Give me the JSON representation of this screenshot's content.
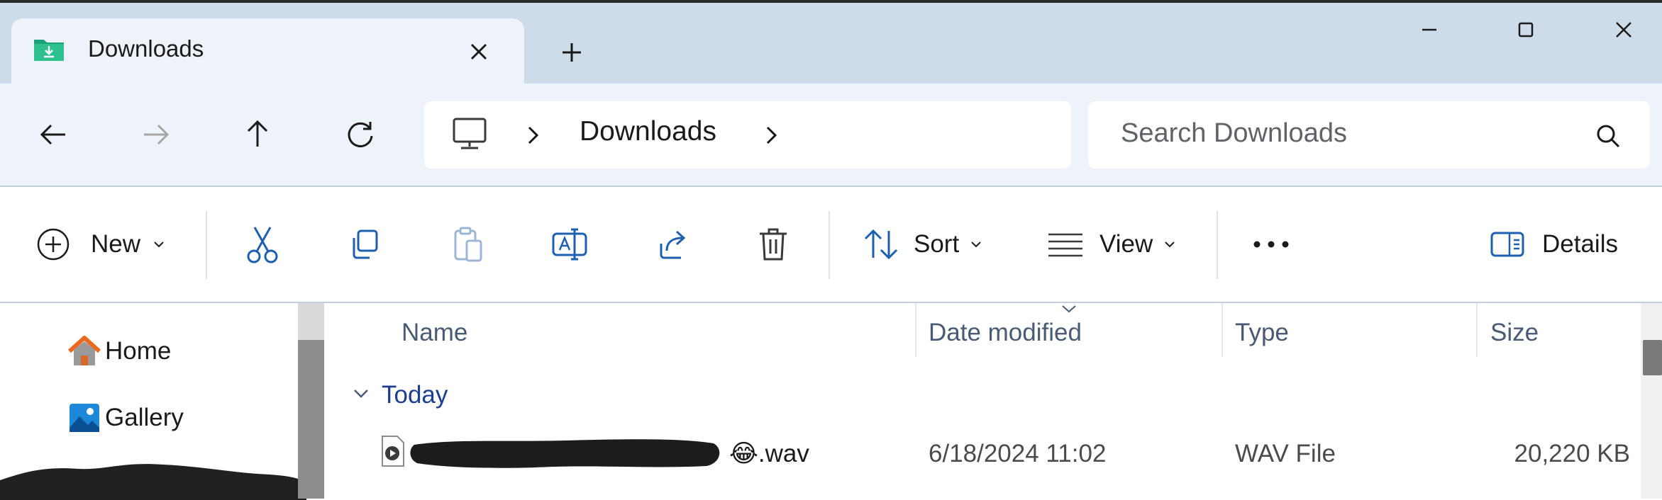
{
  "tab": {
    "title": "Downloads"
  },
  "address_bar": {
    "crumbs": [
      "Downloads"
    ]
  },
  "search": {
    "placeholder": "Search Downloads"
  },
  "commands": {
    "new_label": "New",
    "sort_label": "Sort",
    "view_label": "View",
    "details_label": "Details"
  },
  "nav_pane": {
    "items": [
      {
        "label": "Home"
      },
      {
        "label": "Gallery"
      }
    ]
  },
  "file_list": {
    "columns": [
      "Name",
      "Date modified",
      "Type",
      "Size"
    ],
    "groups": [
      {
        "label": "Today",
        "files": [
          {
            "name_visible": "😂.wav",
            "date_modified": "6/18/2024 11:02",
            "type": "WAV File",
            "size": "20,220 KB"
          }
        ]
      }
    ]
  },
  "colors": {
    "accent_blue": "#1d3d8f",
    "titlebar": "#cedbe8",
    "address_band": "#eef3f9"
  }
}
